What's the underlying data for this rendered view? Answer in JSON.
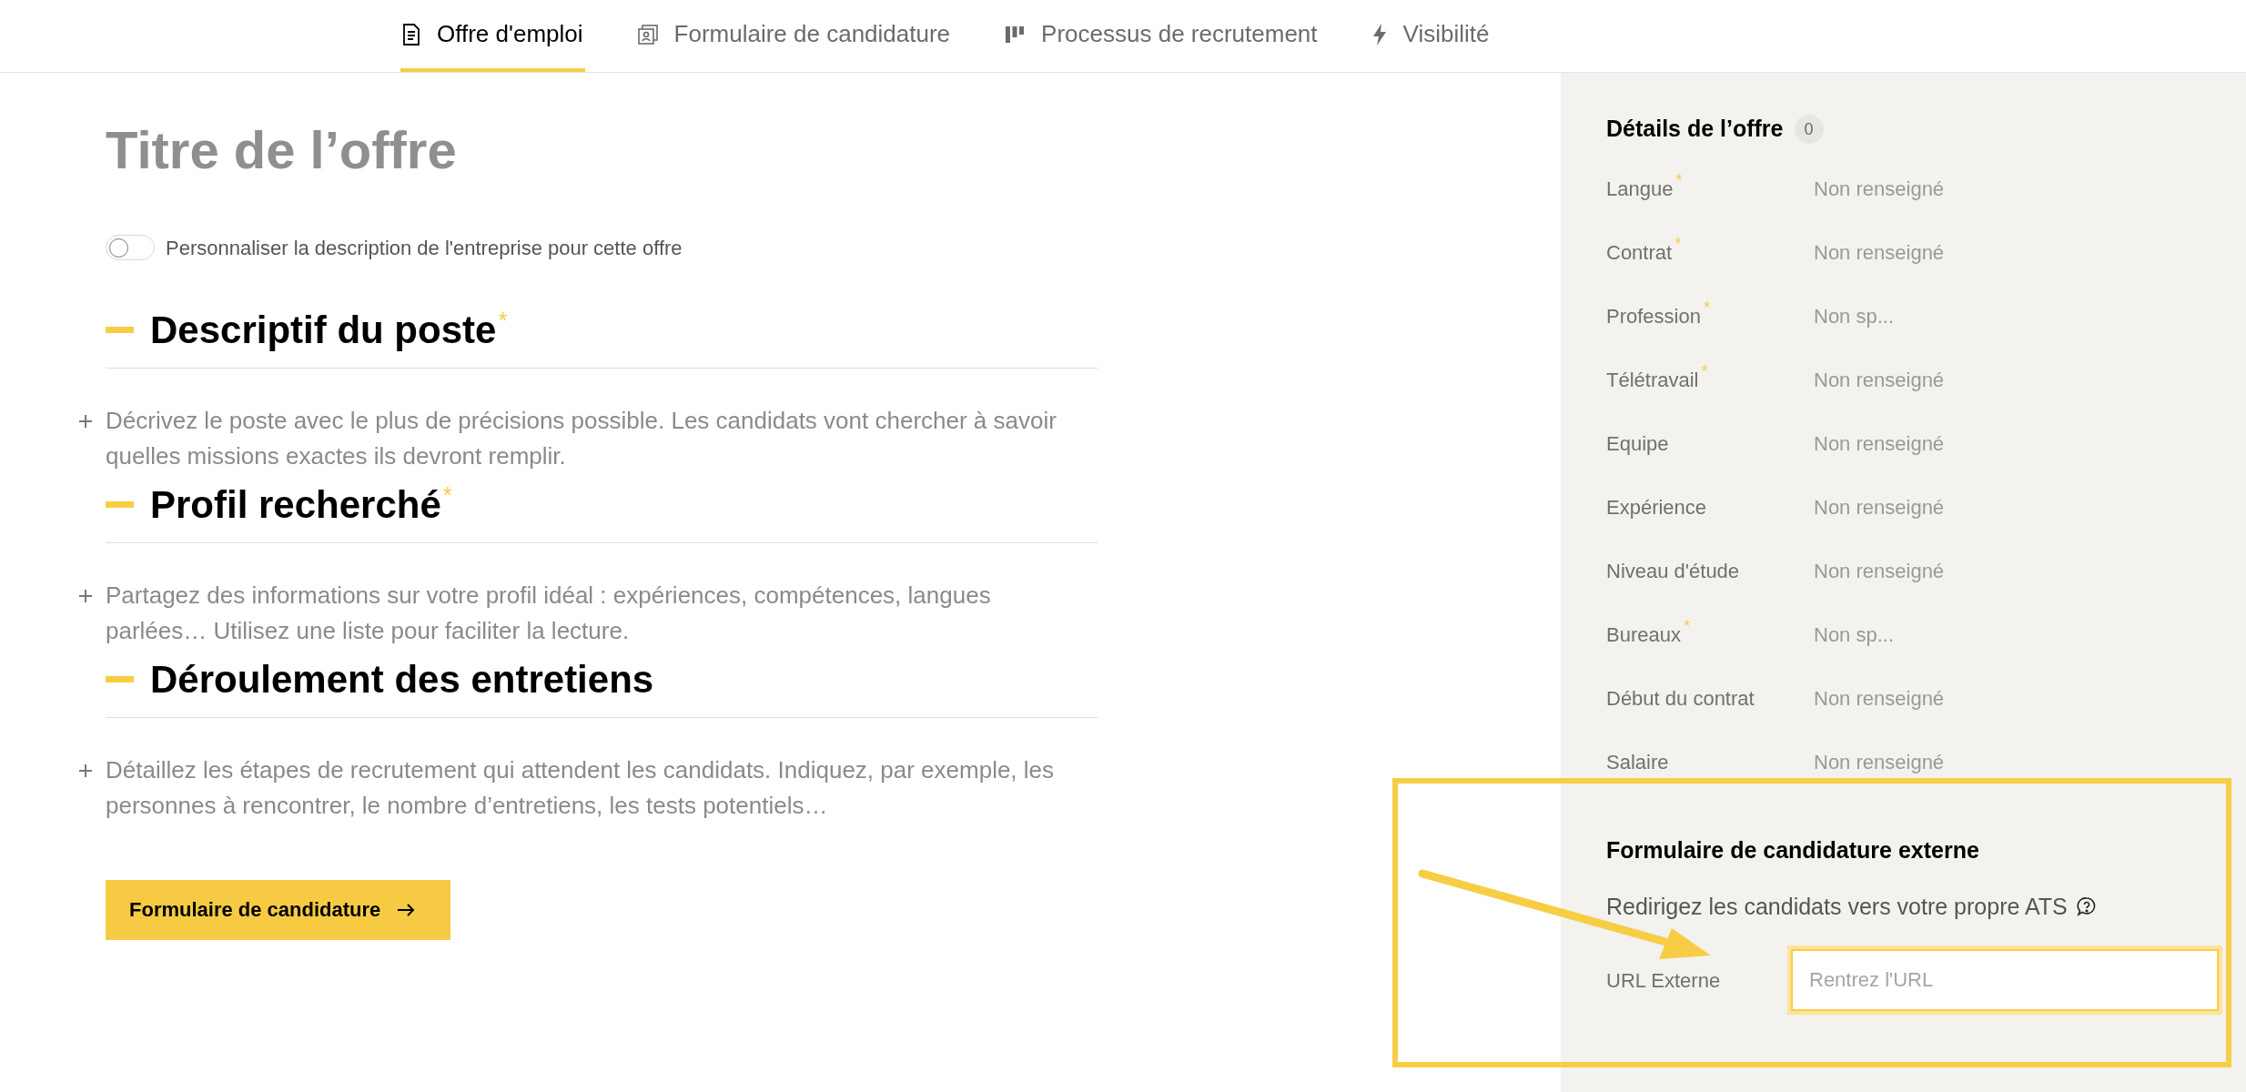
{
  "tabs": [
    {
      "label": "Offre d'emploi",
      "kind": "document",
      "selected": true
    },
    {
      "label": "Formulaire de candidature",
      "kind": "form",
      "selected": false
    },
    {
      "label": "Processus de recrutement",
      "kind": "columns",
      "selected": false
    },
    {
      "label": "Visibilité",
      "kind": "bolt",
      "selected": false
    }
  ],
  "offer_title": "Titre de l’offre",
  "toggle": {
    "label": "Personnaliser la description de l'entreprise pour cette offre",
    "on": false
  },
  "sections": [
    {
      "heading": "Descriptif du poste",
      "marker": "*",
      "placeholder": "Décrivez le poste avec le plus de précisions possible. Les candidats vont chercher à savoir quelles missions exactes ils devront remplir."
    },
    {
      "heading": "Profil recherché",
      "marker": "*",
      "placeholder": "Partagez des informations sur votre profil idéal : expériences, compétences, langues parlées… Utilisez une liste pour faciliter la lecture."
    },
    {
      "heading": "Déroulement des entretiens",
      "placeholder": "Détaillez les étapes de recrutement qui attendent les candidats. Indiquez, par exemple, les personnes à rencontrer, le nombre d’entretiens, les tests potentiels…"
    }
  ],
  "next_button": "Formulaire de candidature",
  "details": {
    "title": "Détails de l’offre",
    "count": "0",
    "rows": [
      {
        "label": "Langue",
        "marker": "*",
        "value": "Non renseigné"
      },
      {
        "label": "Contrat",
        "marker": "*",
        "value": "Non renseigné"
      },
      {
        "label": "Profession",
        "marker": "*",
        "value": "Non sp..."
      },
      {
        "label": "Télétravail",
        "marker": "*",
        "value": "Non renseigné"
      },
      {
        "label": "Equipe",
        "value": "Non renseigné"
      },
      {
        "label": "Expérience",
        "value": "Non renseigné"
      },
      {
        "label": "Niveau d'étude",
        "value": "Non renseigné"
      },
      {
        "label": "Bureaux",
        "marker": "*",
        "value": "Non sp..."
      },
      {
        "label": "Début du contrat",
        "value": "Non renseigné"
      },
      {
        "label": "Salaire",
        "value": "Non renseigné"
      }
    ]
  },
  "external_form": {
    "title": "Formulaire de candidature externe",
    "description": "Redirigez les candidats vers votre propre ATS",
    "url_label": "URL Externe",
    "url_placeholder": "Rentrez l'URL"
  }
}
